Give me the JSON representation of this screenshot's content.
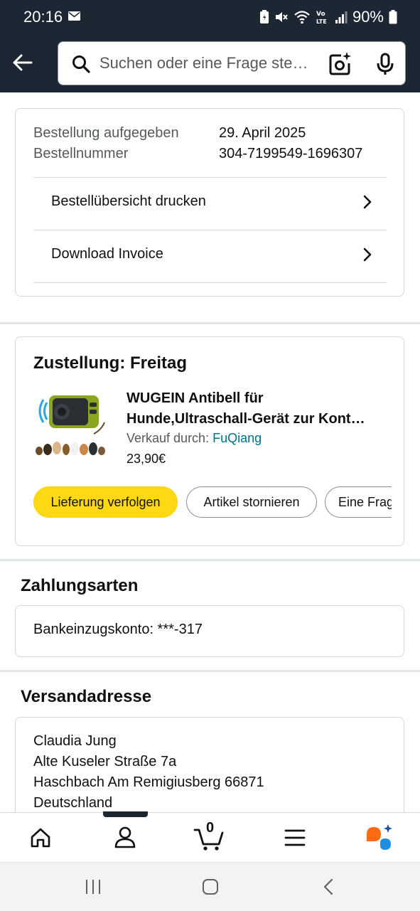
{
  "status_bar": {
    "time": "20:16",
    "battery": "90%"
  },
  "search": {
    "placeholder": "Suchen oder eine Frage ste…"
  },
  "order_info": {
    "placed_label": "Bestellung aufgegeben",
    "placed_value": "29. April 2025",
    "number_label": "Bestellnummer",
    "number_value": "304-7199549-1696307",
    "links": [
      "Bestellübersicht drucken",
      "Download Invoice"
    ]
  },
  "delivery": {
    "heading": "Zustellung: Freitag",
    "product_title_line1": "WUGEIN Antibell für",
    "product_title_line2": "Hunde,Ultraschall-Gerät zur Kont…",
    "seller_label": "Verkauf durch:",
    "seller_name": "FuQiang",
    "price": "23,90€",
    "buttons": {
      "track": "Lieferung verfolgen",
      "cancel": "Artikel stornieren",
      "question": "Eine Frag"
    }
  },
  "payment": {
    "heading": "Zahlungsarten",
    "method": "Bankeinzugskonto: ***-317"
  },
  "shipping": {
    "heading": "Versandadresse",
    "name": "Claudia Jung",
    "street": "Alte Kuseler Straße 7a",
    "city": "Haschbach Am Remigiusberg 66871",
    "country": "Deutschland"
  },
  "bottom_nav": {
    "cart_count": "0",
    "icons": [
      "home-icon",
      "account-icon",
      "cart-icon",
      "menu-icon",
      "rufus-ai-icon"
    ]
  },
  "colors": {
    "header_bg": "#1c2733",
    "accent_yellow": "#ffd814",
    "link_blue": "#007185"
  }
}
